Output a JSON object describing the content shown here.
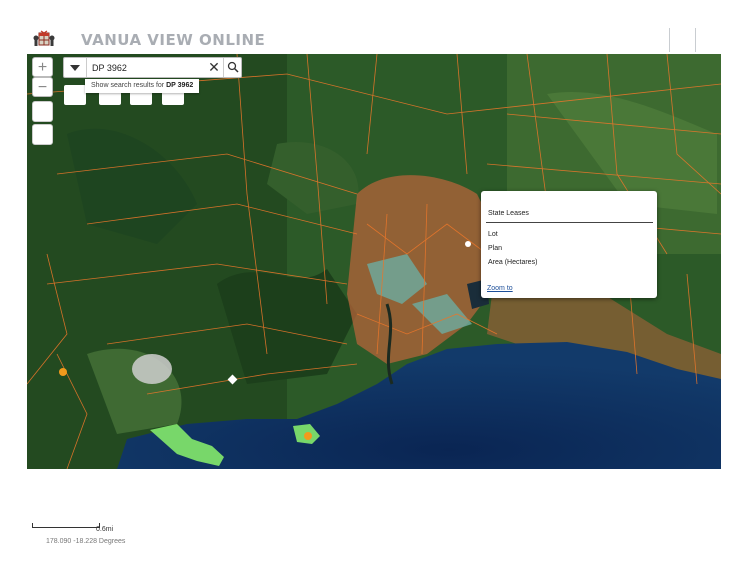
{
  "app": {
    "title": "VANUA VIEW ONLINE"
  },
  "map_controls": {
    "zoom_in": "+",
    "zoom_out": "−"
  },
  "search": {
    "value": "DP 3962",
    "suggestion_prefix": "Show search results for",
    "suggestion_term": "DP 3962"
  },
  "popup": {
    "title": "State Leases",
    "fields": [
      "Lot",
      "Plan",
      "Area (Hectares)"
    ],
    "zoom_link": "Zoom to"
  },
  "status": {
    "scale_label": "0.6mi",
    "coordinates": "178.090 -18.228 Degrees"
  },
  "colors": {
    "parcel_lines": "#e8762b",
    "sea": "#0f2e5c",
    "vegetation": "#2f5a2a",
    "highlight_green": "#7ee06a",
    "marker_orange": "#f29a1c"
  }
}
